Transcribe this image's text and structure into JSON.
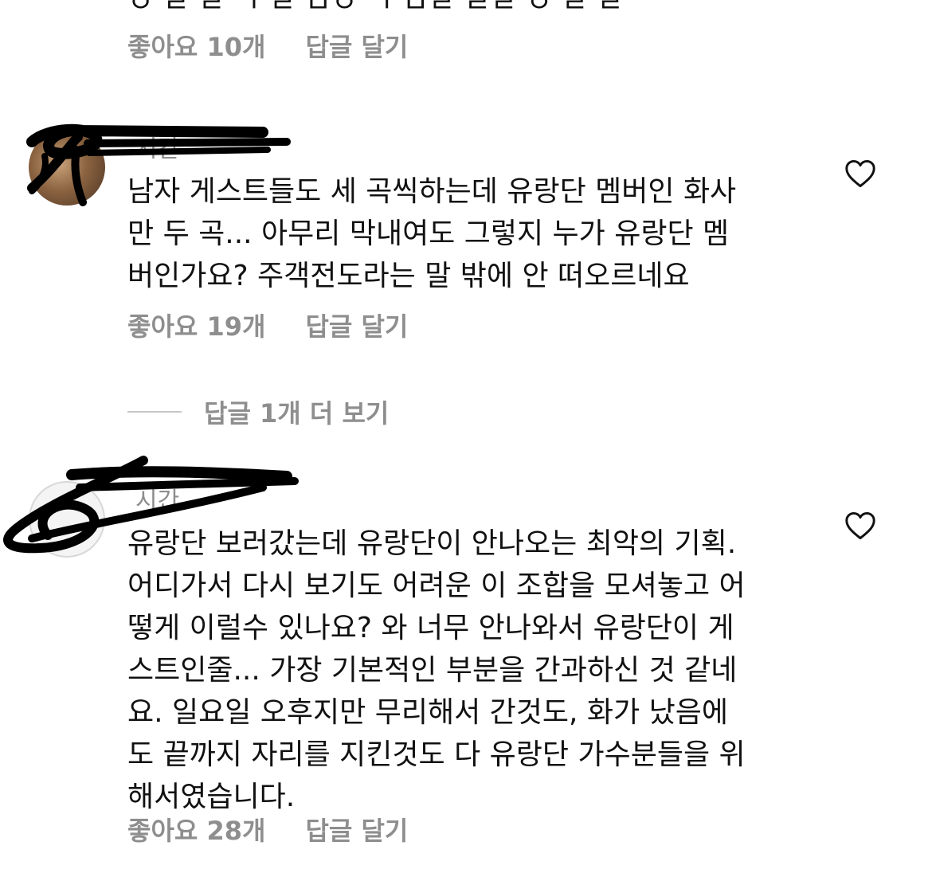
{
  "top": {
    "cut_text": "ㅇ ㄹ ㄹ ㄱ   ㄹ ㅁㅇ ㄱ ㅁㄹ ㄹㄹ ㅇ ㄹ ㄹ",
    "likes": "좋아요 10개",
    "reply": "답글 달기"
  },
  "comments": [
    {
      "username": "",
      "time": "시간",
      "lines": [
        "남자 게스트들도 세 곡씩하는데 유랑단 멤버인 화사",
        "만 두 곡... 아무리 막내여도 그렇지 누가 유랑단 멤",
        "버인가요? 주객전도라는 말 밖에 안 떠오르네요"
      ],
      "likes": "좋아요 19개",
      "reply": "답글 달기",
      "heart_icon": "heart-outline-icon"
    },
    {
      "username": "",
      "time": "시간",
      "lines": [
        "유랑단 보러갔는데 유랑단이 안나오는 최악의 기획.",
        "어디가서 다시 보기도 어려운 이 조합을 모셔놓고 어",
        "떻게 이럴수 있나요? 와 너무 안나와서 유랑단이 게",
        "스트인줄... 가장 기본적인 부분을 간과하신 것 같네",
        "요. 일요일 오후지만 무리해서 간것도, 화가 났음에",
        "도 끝까지 자리를 지킨것도 다 유랑단 가수분들을 위",
        "해서였습니다."
      ],
      "likes": "좋아요 28개",
      "reply": "답글 달기",
      "heart_icon": "heart-outline-icon"
    }
  ],
  "more_replies": "답글 1개 더 보기",
  "colors": {
    "text": "#111111",
    "muted": "#8e8e8e",
    "divider": "#c7c7c7",
    "scribble": "#000000"
  }
}
